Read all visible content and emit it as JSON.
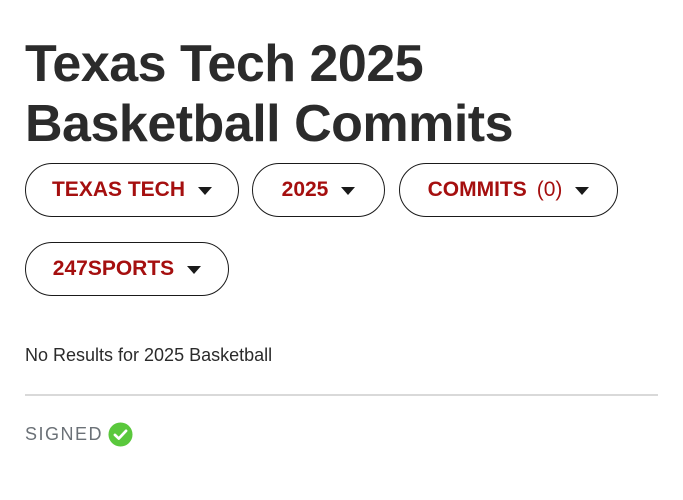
{
  "header": {
    "title": "Texas Tech 2025 Basketball Commits"
  },
  "filters": {
    "team": {
      "label": "TEXAS TECH",
      "icon": "caret-down-icon"
    },
    "year": {
      "label": "2025",
      "icon": "caret-down-icon"
    },
    "type": {
      "label": "COMMITS",
      "count": "(0)",
      "icon": "caret-down-icon"
    },
    "source": {
      "label": "247SPORTS",
      "icon": "caret-down-icon"
    }
  },
  "results": {
    "empty_message": "No Results for 2025 Basketball"
  },
  "legend": {
    "signed_label": "SIGNED",
    "signed_icon": "check-circle-icon"
  },
  "colors": {
    "accent": "#a50f0f",
    "title_text": "#2b2b2b",
    "pill_border": "#1a1a1a",
    "muted_text": "#6b7177",
    "divider": "#d9d9d9",
    "signed_green": "#5ac83c"
  }
}
